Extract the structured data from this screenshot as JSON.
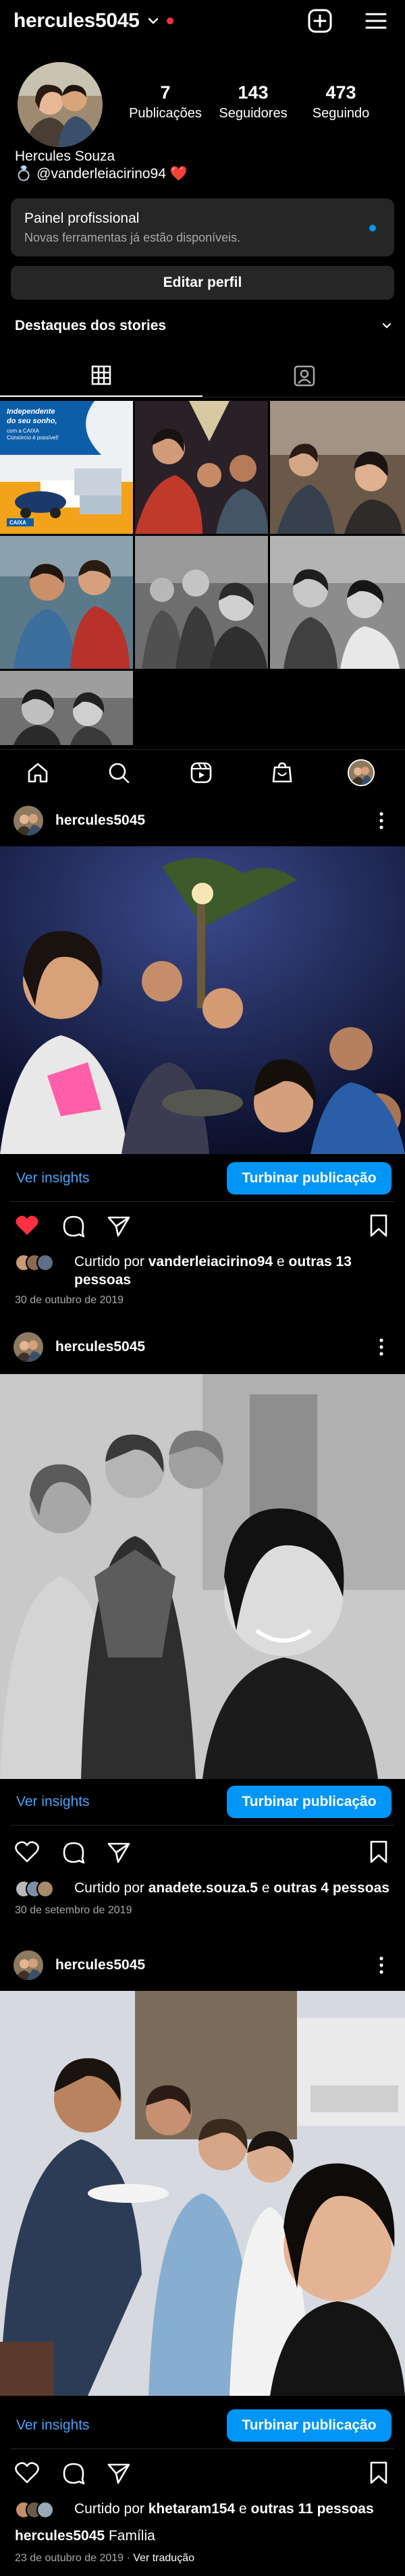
{
  "header": {
    "username": "hercules5045",
    "notification_dot": "#ff3040"
  },
  "profile": {
    "stats": [
      {
        "value": "7",
        "label": "Publicações"
      },
      {
        "value": "143",
        "label": "Seguidores"
      },
      {
        "value": "473",
        "label": "Seguindo"
      }
    ],
    "name": "Hercules Souza",
    "mention": "@vanderleiacirino94",
    "ring_emoji": "💍",
    "heart_emoji": "❤️"
  },
  "pro_panel": {
    "title": "Painel profissional",
    "subtitle": "Novas ferramentas já estão disponíveis.",
    "dot_color": "#0095f6"
  },
  "edit_profile": "Editar perfil",
  "highlights": {
    "label": "Destaques dos stories"
  },
  "grid_ad": {
    "line1": "Independente",
    "line2": "do seu sonho,",
    "line3": "com a CAIXA",
    "line4": "Consórcio é possível!",
    "brand": "CAIXA"
  },
  "posts": [
    {
      "username": "hercules5045",
      "insights": "Ver insights",
      "boost": "Turbinar publicação",
      "liked": true,
      "liked_prefix": "Curtido por",
      "liked_user": "vanderleiacirino94",
      "liked_and": "e",
      "liked_others": "outras 13 pessoas",
      "caption_user": "",
      "caption_text": "",
      "date": "30 de outubro de 2019",
      "translate": ""
    },
    {
      "username": "hercules5045",
      "insights": "Ver insights",
      "boost": "Turbinar publicação",
      "liked": false,
      "liked_prefix": "Curtido por",
      "liked_user": "anadete.souza.5",
      "liked_and": "e",
      "liked_others": "outras 4 pessoas",
      "caption_user": "",
      "caption_text": "",
      "date": "30 de setembro de 2019",
      "translate": ""
    },
    {
      "username": "hercules5045",
      "insights": "Ver insights",
      "boost": "Turbinar publicação",
      "liked": false,
      "liked_prefix": "Curtido por",
      "liked_user": "khetaram154",
      "liked_and": "e",
      "liked_others": "outras 11 pessoas",
      "caption_user": "hercules5045",
      "caption_text": "Família",
      "date": "23 de outubro de 2019",
      "translate": "Ver tradução"
    }
  ],
  "colors": {
    "accent": "#0095f6",
    "like_red": "#ff3040",
    "panel_bg": "#262626",
    "border": "#262626"
  },
  "icons": {
    "header": [
      "chevron-down-icon",
      "add-post-icon",
      "menu-icon"
    ],
    "tabs": [
      "grid-icon",
      "tagged-icon"
    ],
    "nav": [
      "home-icon",
      "search-icon",
      "reels-icon",
      "shop-icon",
      "profile-avatar"
    ],
    "post_actions": [
      "heart-icon",
      "comment-icon",
      "share-icon",
      "bookmark-icon"
    ]
  }
}
